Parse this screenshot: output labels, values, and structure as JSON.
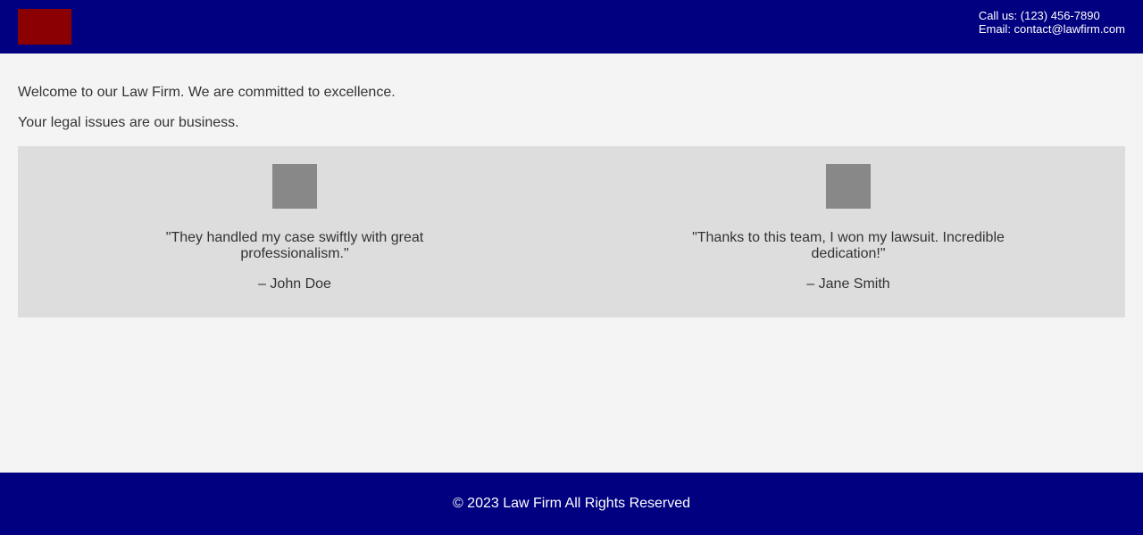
{
  "header": {
    "contact_phone": "Call us: (123) 456-7890",
    "contact_email": "Email: contact@lawfirm.com"
  },
  "intro": {
    "welcome": "Welcome to our Law Firm. We are committed to excellence.",
    "tagline": "Your legal issues are our business."
  },
  "testimonials": [
    {
      "quote": "\"They handled my case swiftly with great professionalism.\"",
      "author": "– John Doe"
    },
    {
      "quote": "\"Thanks to this team, I won my lawsuit. Incredible dedication!\"",
      "author": "– Jane Smith"
    }
  ],
  "footer": {
    "copyright": "© 2023 Law Firm All Rights Reserved"
  },
  "colors": {
    "header_bg": "#000080",
    "logo": "#8b0000",
    "page_bg": "#f4f4f4",
    "testimonial_bg": "#dddddd",
    "avatar": "#888888"
  }
}
